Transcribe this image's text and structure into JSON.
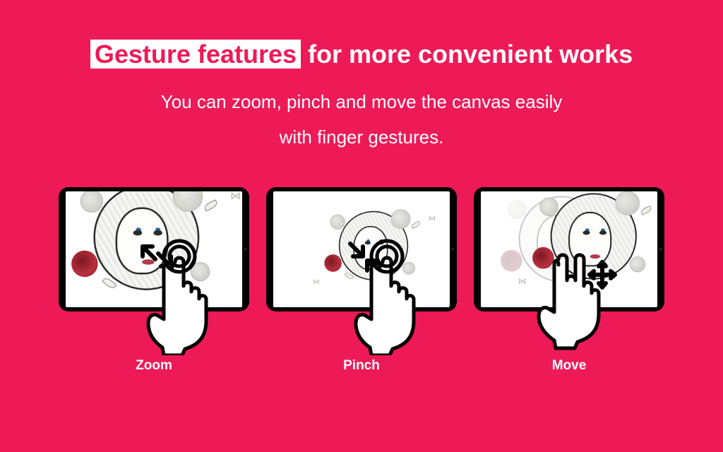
{
  "hero": {
    "title_highlight": "Gesture features",
    "title_rest": " for more convenient works",
    "subtitle_line1": "You can zoom, pinch and move the canvas easily",
    "subtitle_line2": "with finger gestures."
  },
  "cards": [
    {
      "label": "Zoom",
      "gesture": "zoom",
      "icon": "zoom-out-arrows-icon"
    },
    {
      "label": "Pinch",
      "gesture": "pinch",
      "icon": "pinch-in-arrows-icon"
    },
    {
      "label": "Move",
      "gesture": "move",
      "icon": "move-arrows-icon"
    }
  ]
}
